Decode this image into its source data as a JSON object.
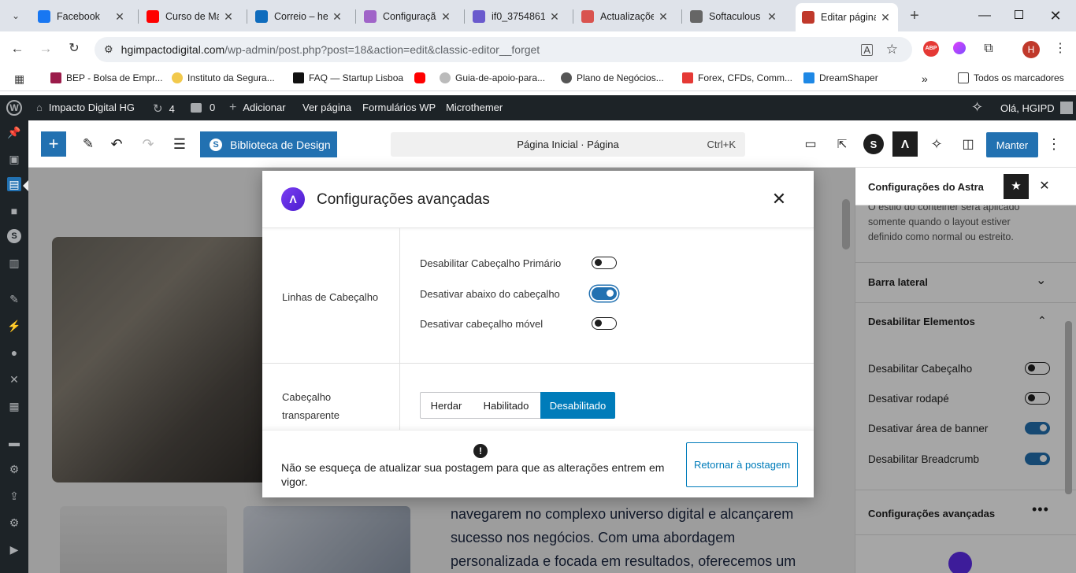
{
  "browser": {
    "tabs": [
      {
        "title": "Facebook",
        "icon": "facebook-icon",
        "color": "#1877f2"
      },
      {
        "title": "Curso de Ma",
        "icon": "youtube-icon",
        "color": "#ff0000"
      },
      {
        "title": "Correio – her",
        "icon": "outlook-icon",
        "color": "#0f6cbd"
      },
      {
        "title": "Configuraçã",
        "icon": "cloud-icon",
        "color": "#a064c8"
      },
      {
        "title": "if0_3754861",
        "icon": "infinity-icon",
        "color": "#6a5acd"
      },
      {
        "title": "Actualizaçõe",
        "icon": "host-icon",
        "color": "#d9534f"
      },
      {
        "title": "Softaculous",
        "icon": "softaculous-icon",
        "color": "#666666"
      },
      {
        "title": "Editar página",
        "icon": "wordpress-icon",
        "color": "#c0392b"
      }
    ],
    "url_host": "hgimpactodigital.com",
    "url_path": "/wp-admin/post.php?post=18&action=edit&classic-editor__forget",
    "profile_initial": "H",
    "bookmarks": [
      "BEP - Bolsa de Empr...",
      "Instituto da Segura...",
      "FAQ — Startup Lisboa",
      "",
      "Guia-de-apoio-para...",
      "Plano de Negócios...",
      "Forex, CFDs, Comm...",
      "DreamShaper"
    ],
    "bookmarks_more": "»",
    "all_bookmarks": "Todos os marcadores"
  },
  "adminbar": {
    "site_name": "Impacto Digital HG",
    "updates": "4",
    "comments": "0",
    "add_new": "Adicionar",
    "view_page": "Ver página",
    "forms": "Formulários WP",
    "microthemer": "Microthemer",
    "greeting": "Olá, HGIPD"
  },
  "toolbar": {
    "design_library": "Biblioteca de Design",
    "doc_title": "Página Inicial · Página",
    "shortcut": "Ctrl+K",
    "save_label": "Manter"
  },
  "canvas": {
    "text_lines": [
      "navegarem no complexo universo digital e alcançarem",
      "sucesso nos negócios. Com uma abordagem",
      "personalizada e focada em resultados, oferecemos um"
    ]
  },
  "right_panel": {
    "title": "Configurações do Astra",
    "clipped_text": [
      "O estilo do contêiner será aplicado",
      "somente quando o layout estiver",
      "definido como normal ou estreito."
    ],
    "sidebar_section": "Barra lateral",
    "disable_section": "Desabilitar Elementos",
    "disable_items": [
      {
        "label": "Desabilitar Cabeçalho",
        "on": false
      },
      {
        "label": "Desativar rodapé",
        "on": false
      },
      {
        "label": "Desativar área de banner",
        "on": true
      },
      {
        "label": "Desabilitar Breadcrumb",
        "on": true
      }
    ],
    "advanced_section": "Configurações avançadas"
  },
  "modal": {
    "title": "Configurações avançadas",
    "header_rows_label": "Linhas de Cabeçalho",
    "header_toggles": [
      {
        "label": "Desabilitar Cabeçalho Primário",
        "on": false
      },
      {
        "label": "Desativar abaixo do cabeçalho",
        "on": true
      },
      {
        "label": "Desativar cabeçalho móvel",
        "on": false
      }
    ],
    "transparent_label": "Cabeçalho transparente",
    "segments": [
      "Herdar",
      "Habilitado",
      "Desabilitado"
    ],
    "selected_segment": "Desabilitado",
    "notice": "Não se esqueça de atualizar sua postagem para que as alterações entrem em vigor.",
    "return_button": "Retornar à postagem"
  },
  "colors": {
    "accent": "#007cba",
    "wp_dark": "#1d2327",
    "toggle_on": "#2271b1",
    "astra_purple": "#5e2ced"
  }
}
